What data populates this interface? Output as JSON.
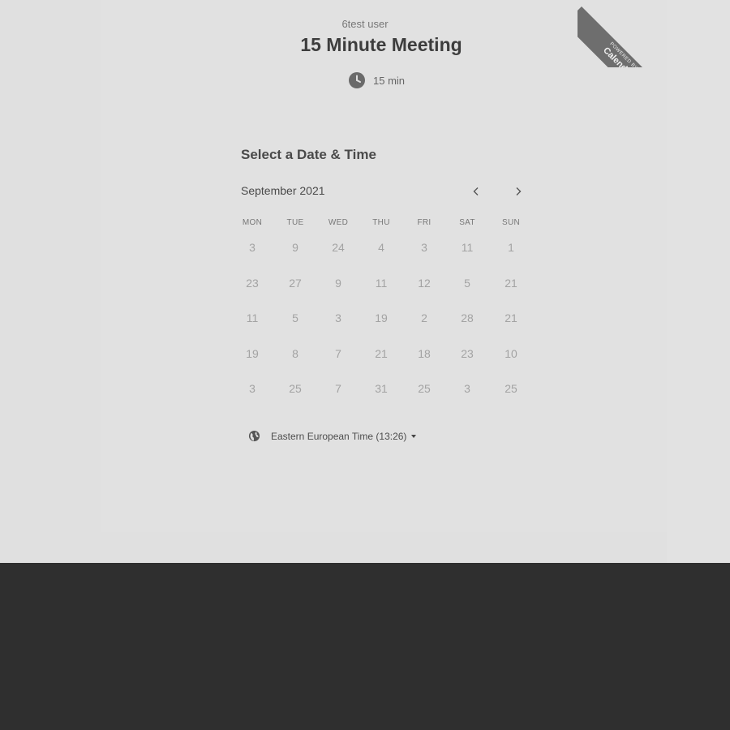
{
  "organizer": "6test user",
  "event_title": "15 Minute Meeting",
  "duration": {
    "icon": "clock-icon",
    "label": "15 min"
  },
  "ribbon": {
    "small": "POWERED BY",
    "big": "Calendly"
  },
  "section_title": "Select a Date & Time",
  "calendar": {
    "month_label": "September 2021",
    "prev_icon": "chevron-left-icon",
    "next_icon": "chevron-right-icon",
    "weekdays": [
      "MON",
      "TUE",
      "WED",
      "THU",
      "FRI",
      "SAT",
      "SUN"
    ],
    "weeks": [
      [
        "3",
        "9",
        "24",
        "4",
        "3",
        "11",
        "1"
      ],
      [
        "23",
        "27",
        "9",
        "11",
        "12",
        "5",
        "21"
      ],
      [
        "11",
        "5",
        "3",
        "19",
        "2",
        "28",
        "21"
      ],
      [
        "19",
        "8",
        "7",
        "21",
        "18",
        "23",
        "10"
      ],
      [
        "3",
        "25",
        "7",
        "31",
        "25",
        "3",
        "25"
      ]
    ]
  },
  "timezone": {
    "icon": "globe-icon",
    "label": "Eastern European Time (13:26)"
  },
  "colors": {
    "page_bg": "#e0e0e0",
    "footer_bg": "#2f2f2f",
    "ribbon_bg": "#6e6e6e"
  }
}
